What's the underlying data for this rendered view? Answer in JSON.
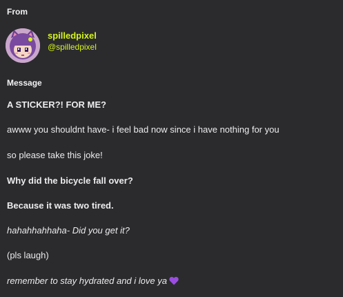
{
  "labels": {
    "from": "From",
    "message": "Message"
  },
  "sender": {
    "display_name": "spilledpixel",
    "handle": "@spilledpixel",
    "avatar_icon": "pixel-character-avatar",
    "name_color": "#d6f51b"
  },
  "message": {
    "lines": [
      "A STICKER?! FOR ME?",
      "awww you shouldnt have- i feel bad now since i have nothing for you",
      "so please take this joke!",
      "Why did the bicycle fall over?",
      "Because it was two tired.",
      "hahahhahhaha- Did you get it?",
      "(pls laugh)",
      "remember to stay hydrated and i love ya"
    ],
    "end_emoji": "purple-heart-icon"
  },
  "colors": {
    "background": "#2b2b2e",
    "heart": "#9b4de0"
  }
}
